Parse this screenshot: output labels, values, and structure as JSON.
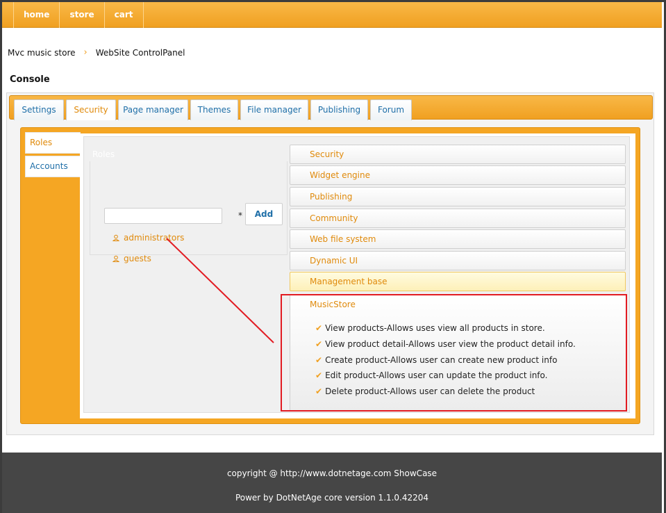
{
  "nav": {
    "items": [
      {
        "label": "home"
      },
      {
        "label": "store"
      },
      {
        "label": "cart"
      }
    ]
  },
  "breadcrumb": {
    "items": [
      "Mvc music store",
      "WebSite ControlPanel"
    ],
    "separator": "›"
  },
  "console": {
    "title": "Console",
    "tabs": [
      {
        "label": "Settings"
      },
      {
        "label": "Security"
      },
      {
        "label": "Page manager"
      },
      {
        "label": "Themes"
      },
      {
        "label": "File manager"
      },
      {
        "label": "Publishing"
      },
      {
        "label": "Forum"
      }
    ],
    "active_tab": "Security"
  },
  "security": {
    "side_tabs": [
      {
        "label": "Roles"
      },
      {
        "label": "Accounts"
      }
    ],
    "active_side_tab": "Roles",
    "roles": {
      "label": "Roles",
      "input_value": "",
      "required_marker": "*",
      "add_label": "Add",
      "items": [
        {
          "name": "administrators"
        },
        {
          "name": "guests"
        }
      ]
    },
    "accordion": {
      "items": [
        {
          "label": "Security"
        },
        {
          "label": "Widget engine"
        },
        {
          "label": "Publishing"
        },
        {
          "label": "Community"
        },
        {
          "label": "Web file system"
        },
        {
          "label": "Dynamic UI"
        },
        {
          "label": "Management base"
        }
      ],
      "highlighted": "Management base",
      "open_section": {
        "title": "MusicStore",
        "permissions": [
          "View products-Allows uses view all products in store.",
          "View product detail-Allows user view the product detail info.",
          "Create product-Allows user can create new product info",
          "Edit product-Allows user can update the product info.",
          "Delete product-Allows user can delete the product"
        ]
      }
    }
  },
  "footer": {
    "copyright": "copyright @ http://www.dotnetage.com ShowCase",
    "power": "Power by DotNetAge core version 1.1.0.42204"
  },
  "colors": {
    "accent": "#f5a623",
    "link": "#1f6fa8",
    "highlight_text": "#e08a0b",
    "annotation": "#e21b22",
    "footer_bg": "#464646"
  }
}
